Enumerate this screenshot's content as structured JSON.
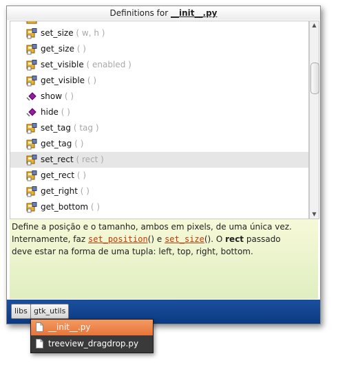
{
  "window": {
    "title_prefix": "Definitions for ",
    "title_file": "__init__.py"
  },
  "definitions": [
    {
      "name": "set_size",
      "args": " ( w, h )",
      "icon": "method-icon",
      "selected": false
    },
    {
      "name": "get_size",
      "args": " ( )",
      "icon": "method-icon",
      "selected": false
    },
    {
      "name": "set_visible",
      "args": " ( enabled )",
      "icon": "method-icon",
      "selected": false
    },
    {
      "name": "get_visible",
      "args": " ( )",
      "icon": "method-icon",
      "selected": false
    },
    {
      "name": "show",
      "args": " ( )",
      "icon": "function-icon",
      "selected": false
    },
    {
      "name": "hide",
      "args": " ( )",
      "icon": "function-icon",
      "selected": false
    },
    {
      "name": "set_tag",
      "args": " ( tag )",
      "icon": "method-icon",
      "selected": false
    },
    {
      "name": "get_tag",
      "args": " ( )",
      "icon": "method-icon",
      "selected": false
    },
    {
      "name": "set_rect",
      "args": " ( rect )",
      "icon": "method-icon",
      "selected": true
    },
    {
      "name": "get_rect",
      "args": " ( )",
      "icon": "method-icon",
      "selected": false
    },
    {
      "name": "get_right",
      "args": " ( )",
      "icon": "method-icon",
      "selected": false
    },
    {
      "name": "get_bottom",
      "args": " ( )",
      "icon": "method-icon",
      "selected": false
    }
  ],
  "doc": {
    "line1": "Define a posição e o tamanho, ambos em pixels, de uma única vez.",
    "line2_a": "Internamente, faz ",
    "link1": "set_position",
    "line2_b": "() e ",
    "link2": "set_size",
    "line2_c": "(). O ",
    "bold": "rect",
    "line2_d": " passado",
    "line3": "deve estar na forma de uma tupla: left, top, right, bottom."
  },
  "pathbar": {
    "crumbs": [
      "libs",
      "gtk_utils"
    ]
  },
  "popup": {
    "items": [
      {
        "label": "__init__.py",
        "active": true
      },
      {
        "label": "treeview_dragdrop.py",
        "active": false
      }
    ]
  },
  "colors": {
    "selection": "#e6e6e6",
    "doc_bg": "#eef4cc",
    "pathbar": "#0b3a82",
    "popup_active": "#ee8548",
    "link": "#cc3300"
  }
}
